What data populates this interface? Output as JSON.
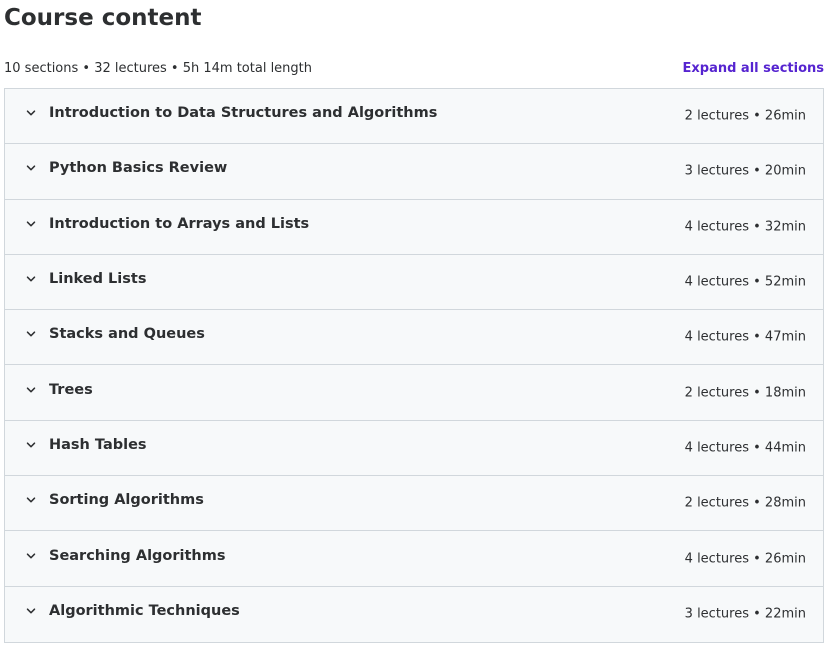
{
  "header": {
    "title": "Course content",
    "summary": "10 sections • 32 lectures • 5h 14m total length",
    "expand_label": "Expand all sections"
  },
  "icons": {
    "section_toggle": "chevron-down-icon"
  },
  "colors": {
    "accent": "#5624d0",
    "section_bg": "#f7f9fa",
    "border": "#d1d7dc",
    "text": "#2d2f31"
  },
  "sections": [
    {
      "title": "Introduction to Data Structures and Algorithms",
      "meta": "2 lectures • 26min"
    },
    {
      "title": "Python Basics Review",
      "meta": "3 lectures • 20min"
    },
    {
      "title": "Introduction to Arrays and Lists",
      "meta": "4 lectures • 32min"
    },
    {
      "title": "Linked Lists",
      "meta": "4 lectures • 52min"
    },
    {
      "title": "Stacks and Queues",
      "meta": "4 lectures • 47min"
    },
    {
      "title": "Trees",
      "meta": "2 lectures • 18min"
    },
    {
      "title": "Hash Tables",
      "meta": "4 lectures • 44min"
    },
    {
      "title": "Sorting Algorithms",
      "meta": "2 lectures • 28min"
    },
    {
      "title": "Searching Algorithms",
      "meta": "4 lectures • 26min"
    },
    {
      "title": "Algorithmic Techniques",
      "meta": "3 lectures • 22min"
    }
  ]
}
